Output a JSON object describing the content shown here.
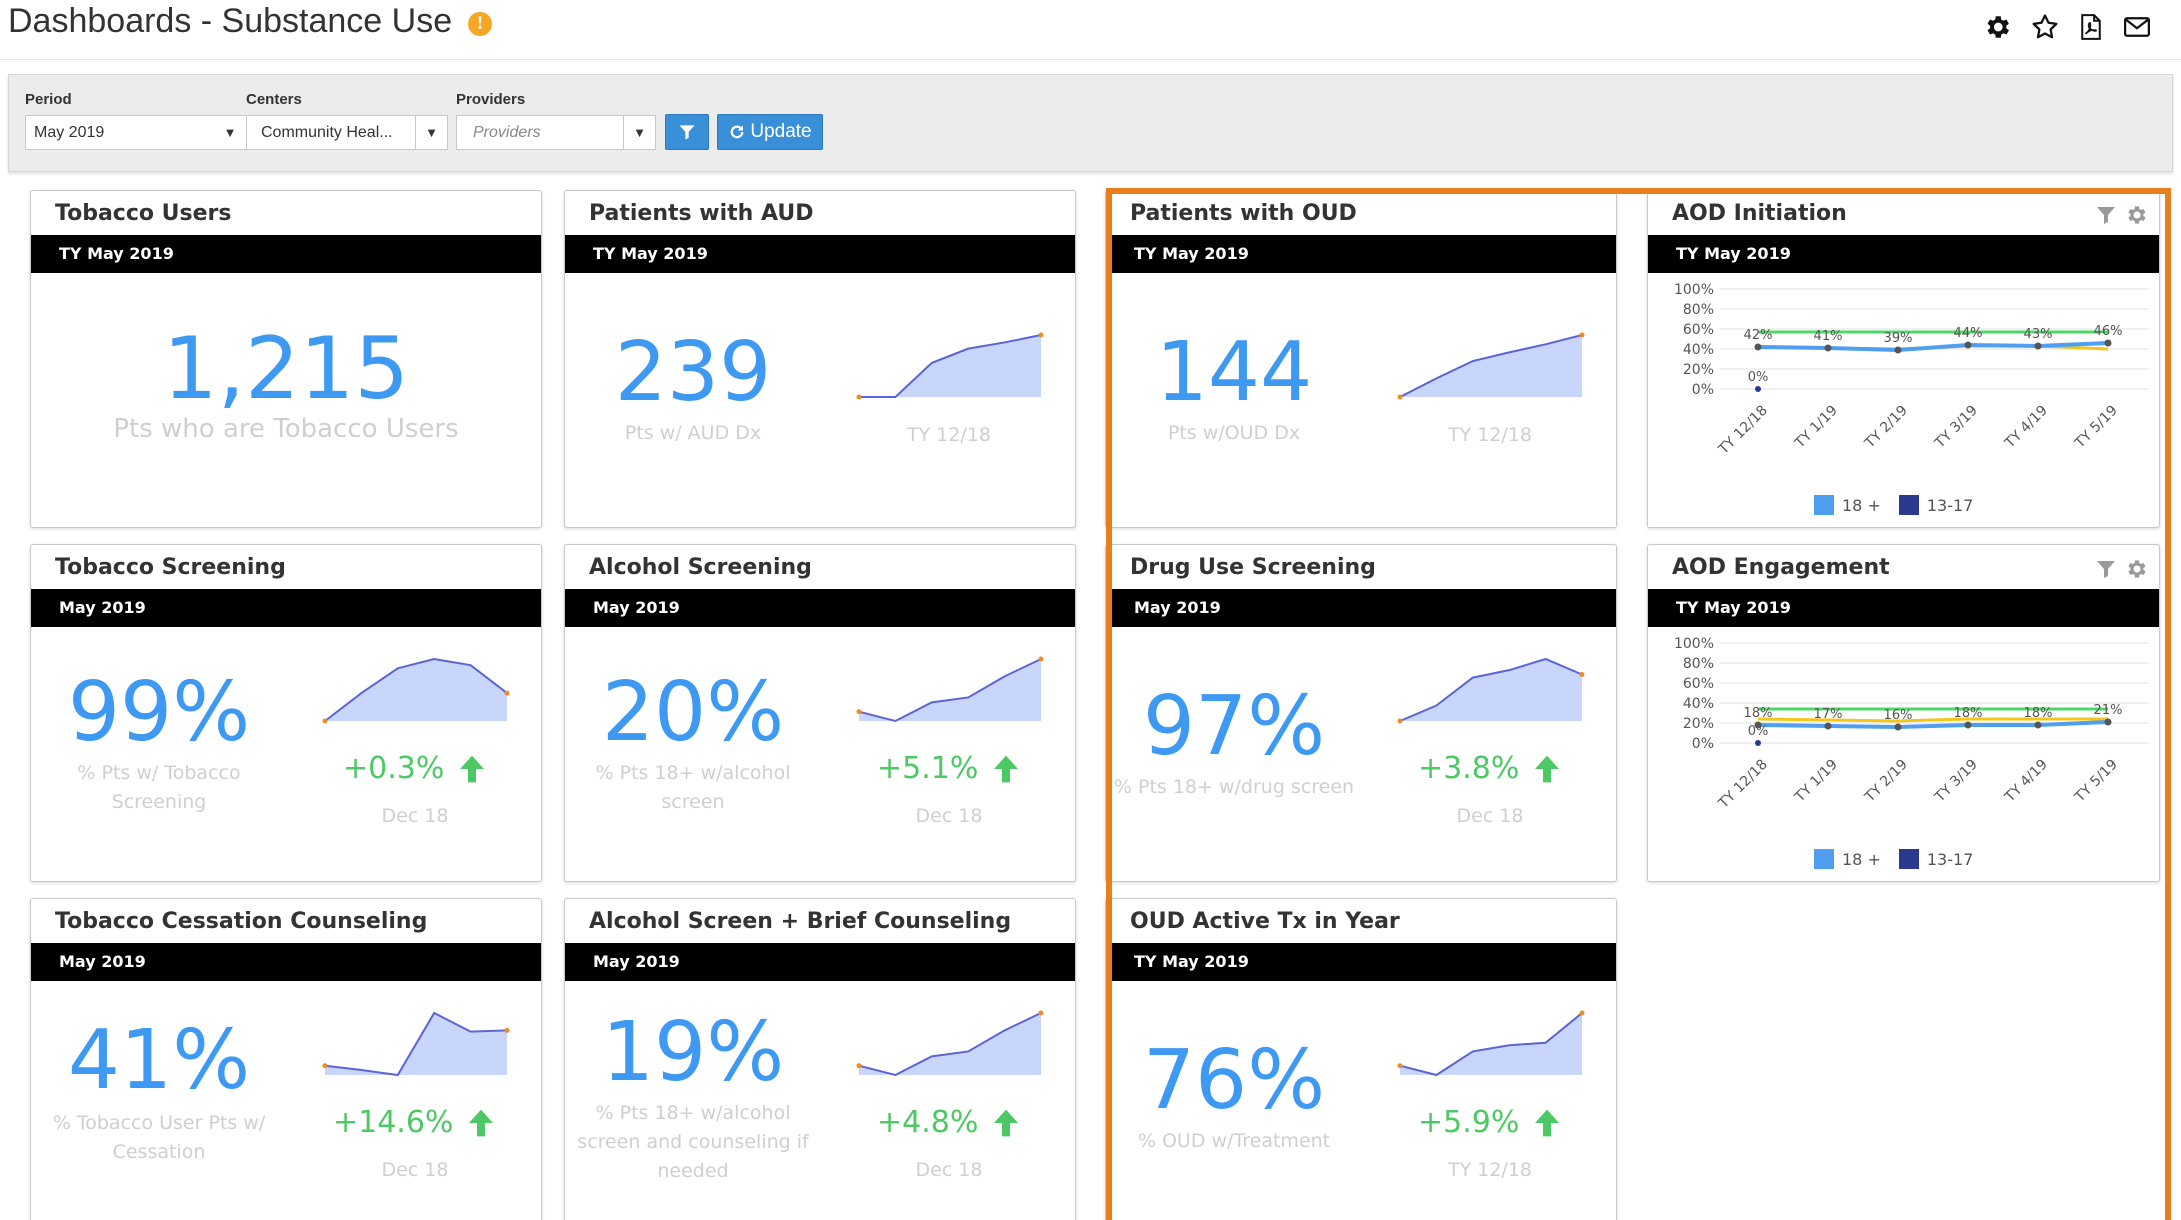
{
  "header": {
    "title": "Dashboards - Substance Use",
    "info_icon": "info-icon",
    "icons": [
      "gear-icon",
      "star-icon",
      "pdf-icon",
      "mail-icon"
    ]
  },
  "filters": {
    "period_label": "Period",
    "period_value": "May 2019",
    "centers_label": "Centers",
    "centers_value": "Community Heal...",
    "providers_label": "Providers",
    "providers_placeholder": "Providers",
    "filter_icon": "filter-icon",
    "update_label": "Update"
  },
  "colors": {
    "accent_blue": "#3d99f2",
    "positive_green": "#4cc964",
    "highlight_orange": "#ea7e1c",
    "series_18_plus": "#4f9ef0",
    "series_13_17": "#2b3a8f"
  },
  "tiles": {
    "tobacco_users": {
      "title": "Tobacco Users",
      "band": "TY May 2019",
      "value": "1,215",
      "caption": "Pts who are Tobacco Users"
    },
    "aud": {
      "title": "Patients with AUD",
      "band": "TY May 2019",
      "value": "239",
      "caption": "Pts w/ AUD Dx",
      "spark_caption": "TY 12/18",
      "spark": [
        0.0,
        0.0,
        0.55,
        0.78,
        0.88,
        1.0
      ]
    },
    "oud": {
      "title": "Patients with OUD",
      "band": "TY May 2019",
      "value": "144",
      "caption": "Pts w/OUD Dx",
      "spark_caption": "TY 12/18",
      "spark": [
        0.0,
        0.3,
        0.58,
        0.72,
        0.85,
        1.0
      ]
    },
    "tobacco_screening": {
      "title": "Tobacco Screening",
      "band": "May 2019",
      "value": "99%",
      "caption_line1": "% Pts w/ Tobacco",
      "caption_line2": "Screening",
      "delta": "+0.3%",
      "delta_caption": "Dec 18",
      "spark": [
        0.0,
        0.45,
        0.85,
        1.0,
        0.9,
        0.45
      ]
    },
    "alcohol_screening": {
      "title": "Alcohol Screening",
      "band": "May 2019",
      "value": "20%",
      "caption_line1": "% Pts 18+ w/alcohol",
      "caption_line2": "screen",
      "delta": "+5.1%",
      "delta_caption": "Dec 18",
      "spark": [
        0.15,
        0.0,
        0.3,
        0.38,
        0.72,
        1.0
      ]
    },
    "drug_screening": {
      "title": "Drug Use Screening",
      "band": "May 2019",
      "value": "97%",
      "caption": "% Pts 18+ w/drug screen",
      "delta": "+3.8%",
      "delta_caption": "Dec 18",
      "spark": [
        0.0,
        0.25,
        0.7,
        0.82,
        1.0,
        0.75
      ]
    },
    "cessation": {
      "title": "Tobacco Cessation Counseling",
      "band": "May 2019",
      "value": "41%",
      "caption_line1": "% Tobacco User Pts w/",
      "caption_line2": "Cessation",
      "delta": "+14.6%",
      "delta_caption": "Dec 18",
      "spark": [
        0.15,
        0.08,
        0.0,
        1.0,
        0.7,
        0.72
      ]
    },
    "brief_counseling": {
      "title": "Alcohol Screen + Brief Counseling",
      "band": "May 2019",
      "value": "19%",
      "caption_line1": "% Pts 18+ w/alcohol",
      "caption_line2": "screen and counseling if",
      "caption_line3": "needed",
      "delta": "+4.8%",
      "delta_caption": "Dec 18",
      "spark": [
        0.15,
        0.0,
        0.3,
        0.38,
        0.72,
        1.0
      ]
    },
    "oud_active": {
      "title": "OUD Active Tx in Year",
      "band": "TY May 2019",
      "value": "76%",
      "caption": "% OUD w/Treatment",
      "delta": "+5.9%",
      "delta_caption": "TY 12/18",
      "spark": [
        0.15,
        0.0,
        0.38,
        0.48,
        0.52,
        1.0
      ]
    },
    "aod_initiation": {
      "title": "AOD Initiation",
      "band": "TY May 2019",
      "legend_a": "18 +",
      "legend_b": "13-17"
    },
    "aod_engagement": {
      "title": "AOD Engagement",
      "band": "TY May 2019",
      "legend_a": "18 +",
      "legend_b": "13-17"
    }
  },
  "chart_data": [
    {
      "type": "line",
      "title": "AOD Initiation",
      "categories": [
        "TY 12/18",
        "TY 1/19",
        "TY 2/19",
        "TY 3/19",
        "TY 4/19",
        "TY 5/19"
      ],
      "y_ticks": [
        "100%",
        "80%",
        "60%",
        "40%",
        "20%",
        "0%"
      ],
      "ylim": [
        0,
        100
      ],
      "series": [
        {
          "name": "18 +",
          "values": [
            42,
            41,
            39,
            44,
            43,
            46
          ],
          "labels": [
            "42%",
            "41%",
            "39%",
            "44%",
            "43%",
            "46%"
          ]
        },
        {
          "name": "13-17",
          "values": [
            0,
            null,
            null,
            null,
            null,
            null
          ],
          "labels": [
            "0%",
            "",
            "",
            "",
            "",
            ""
          ]
        }
      ],
      "reference_lines": [
        {
          "color": "#4cd964",
          "values": [
            57,
            57,
            57,
            57,
            57,
            57
          ]
        },
        {
          "color": "#f5c518",
          "values": [
            42,
            41,
            40,
            43,
            43,
            40
          ]
        }
      ],
      "legend": "bottom",
      "grid": true
    },
    {
      "type": "line",
      "title": "AOD Engagement",
      "categories": [
        "TY 12/18",
        "TY 1/19",
        "TY 2/19",
        "TY 3/19",
        "TY 4/19",
        "TY 5/19"
      ],
      "y_ticks": [
        "100%",
        "80%",
        "60%",
        "40%",
        "20%",
        "0%"
      ],
      "ylim": [
        0,
        100
      ],
      "series": [
        {
          "name": "18 +",
          "values": [
            18,
            17,
            16,
            18,
            18,
            21
          ],
          "labels": [
            "18%",
            "17%",
            "16%",
            "18%",
            "18%",
            "21%"
          ]
        },
        {
          "name": "13-17",
          "values": [
            0,
            null,
            null,
            null,
            null,
            null
          ],
          "labels": [
            "0%",
            "",
            "",
            "",
            "",
            ""
          ]
        }
      ],
      "reference_lines": [
        {
          "color": "#4cd964",
          "values": [
            34,
            34,
            34,
            34,
            34,
            34
          ]
        },
        {
          "color": "#f5c518",
          "values": [
            24,
            23,
            22,
            24,
            24,
            24
          ]
        }
      ],
      "legend": "bottom",
      "grid": true
    }
  ]
}
